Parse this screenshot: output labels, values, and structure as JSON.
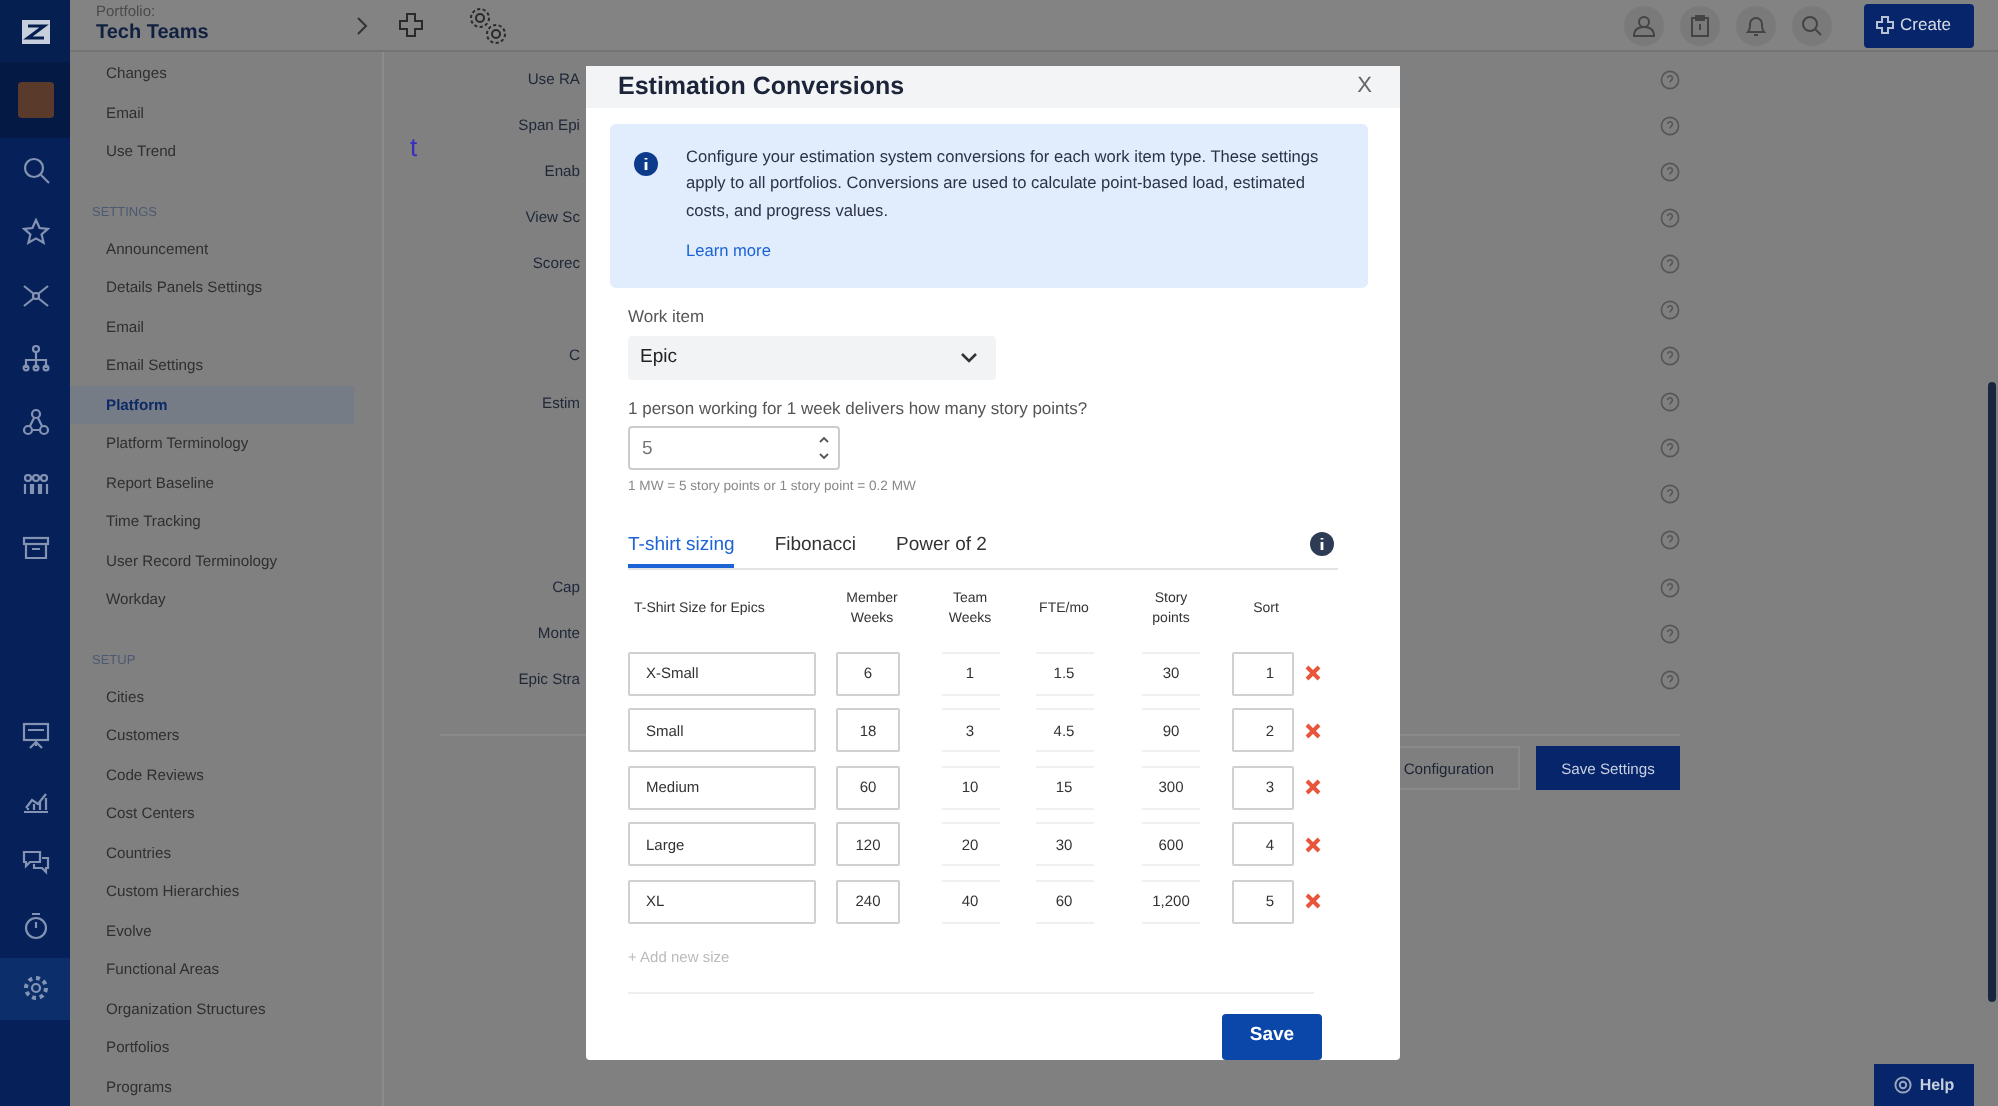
{
  "app_rail": {
    "items": [
      {
        "selected": false
      },
      {
        "selected": false
      },
      {
        "selected": false
      },
      {
        "selected": false
      },
      {
        "selected": false
      },
      {
        "selected": false
      },
      {
        "selected": false
      },
      {
        "selected": false
      },
      {
        "selected": false
      },
      {
        "selected": false
      },
      {
        "selected": false
      },
      {
        "selected": true
      }
    ]
  },
  "top_bar": {
    "portfolio_label": "Portfolio:",
    "portfolio_name": "Tech Teams",
    "create_button": "Create"
  },
  "settings_nav": {
    "groups": [
      {
        "items": [
          {
            "label": "Changes",
            "selected": false
          },
          {
            "label": "Email",
            "selected": false
          },
          {
            "label": "Use Trend",
            "selected": false
          }
        ]
      },
      {
        "heading": "SETTINGS",
        "items": [
          {
            "label": "Announcement",
            "selected": false
          },
          {
            "label": "Details Panels Settings",
            "selected": false
          },
          {
            "label": "Email",
            "selected": false
          },
          {
            "label": "Email Settings",
            "selected": false
          },
          {
            "label": "Platform",
            "selected": true
          },
          {
            "label": "Platform Terminology",
            "selected": false
          },
          {
            "label": "Report Baseline",
            "selected": false
          },
          {
            "label": "Time Tracking",
            "selected": false
          },
          {
            "label": "User Record Terminology",
            "selected": false
          },
          {
            "label": "Workday",
            "selected": false
          }
        ]
      },
      {
        "heading": "SETUP",
        "items": [
          {
            "label": "Cities",
            "selected": false
          },
          {
            "label": "Customers",
            "selected": false
          },
          {
            "label": "Code Reviews",
            "selected": false
          },
          {
            "label": "Cost Centers",
            "selected": false
          },
          {
            "label": "Countries",
            "selected": false
          },
          {
            "label": "Custom Hierarchies",
            "selected": false
          },
          {
            "label": "Evolve",
            "selected": false
          },
          {
            "label": "Functional Areas",
            "selected": false
          },
          {
            "label": "Organization Structures",
            "selected": false
          },
          {
            "label": "Portfolios",
            "selected": false
          },
          {
            "label": "Programs",
            "selected": false
          }
        ]
      }
    ]
  },
  "main": {
    "stray_text": "t",
    "rows": [
      {
        "label": "Use RA"
      },
      {
        "label": "Span Epi"
      },
      {
        "label": "Enab"
      },
      {
        "label": "View Sc"
      },
      {
        "label": "Scorec"
      },
      {},
      {
        "label": "C"
      },
      {
        "label": "Estim"
      },
      {},
      {},
      {},
      {
        "label": "Cap"
      },
      {
        "label": "Monte"
      },
      {
        "label": "Epic Stra"
      }
    ],
    "buttons": [
      "Configuration",
      "Save Settings"
    ]
  },
  "help_button": "Help",
  "modal": {
    "title": "Estimation Conversions",
    "close": "X",
    "info": {
      "text": "Configure your estimation system conversions for each work item type. These settings apply to all portfolios. Conversions are used to calculate point-based load, estimated costs, and progress values.",
      "link": "Learn more"
    },
    "work_item": {
      "label": "Work item",
      "value": "Epic"
    },
    "points_question": {
      "label": "1 person working for 1 week delivers how many story points?",
      "value": "5",
      "hint": "1 MW = 5 story points or 1 story point = 0.2 MW"
    },
    "tabs": [
      {
        "label": "T-shirt sizing",
        "selected": true
      },
      {
        "label": "Fibonacci",
        "selected": false
      },
      {
        "label": "Power of 2",
        "selected": false
      }
    ],
    "table": {
      "columns": [
        "T-Shirt Size for Epics",
        "Member Weeks",
        "Team Weeks",
        "FTE/mo",
        "Story points",
        "Sort"
      ],
      "rows": [
        {
          "size": "X-Small",
          "member_weeks": "6",
          "team_weeks": "1",
          "fte_per_month": "1.5",
          "story_points": "30",
          "sort": "1"
        },
        {
          "size": "Small",
          "member_weeks": "18",
          "team_weeks": "3",
          "fte_per_month": "4.5",
          "story_points": "90",
          "sort": "2"
        },
        {
          "size": "Medium",
          "member_weeks": "60",
          "team_weeks": "10",
          "fte_per_month": "15",
          "story_points": "300",
          "sort": "3"
        },
        {
          "size": "Large",
          "member_weeks": "120",
          "team_weeks": "20",
          "fte_per_month": "30",
          "story_points": "600",
          "sort": "4"
        },
        {
          "size": "XL",
          "member_weeks": "240",
          "team_weeks": "40",
          "fte_per_month": "60",
          "story_points": "1,200",
          "sort": "5"
        }
      ]
    },
    "add_link": "+ Add new size",
    "save_button": "Save"
  }
}
